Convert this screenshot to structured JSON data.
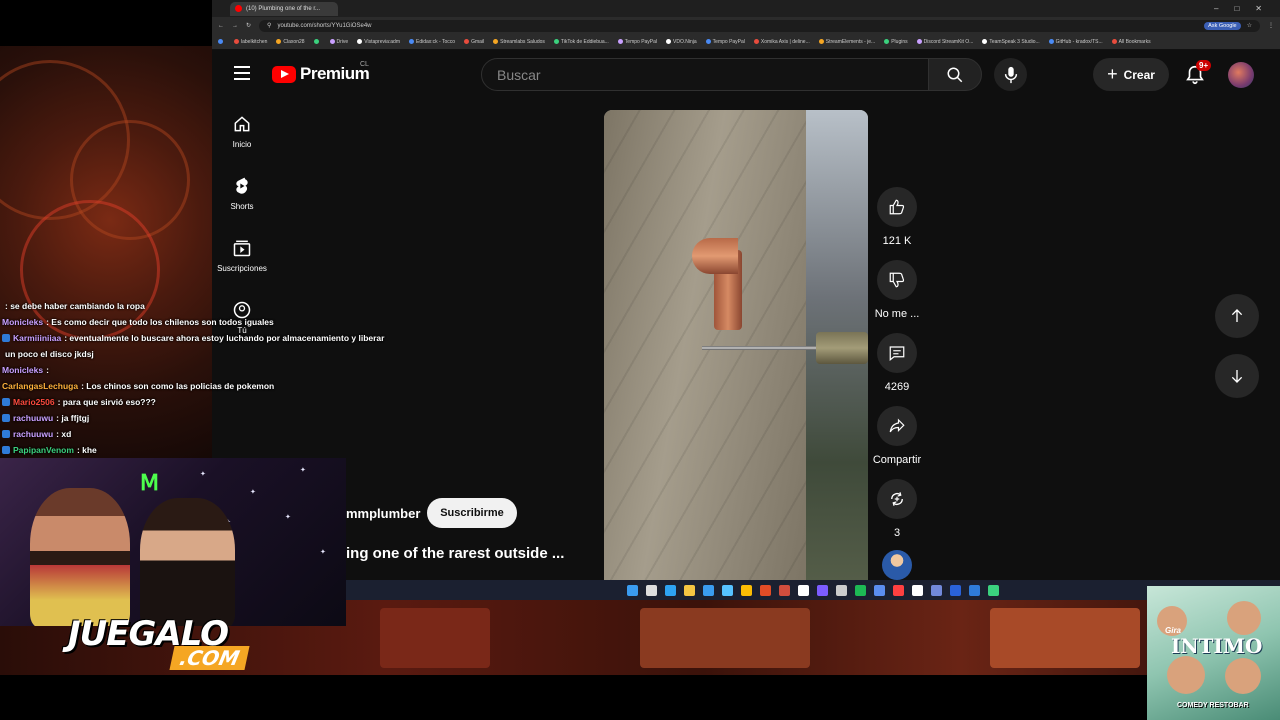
{
  "browser": {
    "tab_title": "(10) Plumbing one of the r...",
    "url": "youtube.com/shorts/YYu1GiOSe4w",
    "ask_google": "Ask Google",
    "bookmarks": [
      "",
      "labelkitchen",
      "Claxon28",
      "",
      "Drive",
      "Vistaprevia:adm",
      "Edidax:ck - Tocco",
      "Gmail",
      "Streamlabs Saludos",
      "TikTok de Eddiebua...",
      "Tempo PayPal",
      "VDO.Ninja",
      "Tempo PayPal",
      "Xomika Axis | deline...",
      "StreamElements - je...",
      "Plugins",
      "Discord StreamKit O...",
      "TeamSpeak 3 Studio...",
      "GitHub - kradox/TS...",
      "All Bookmarks"
    ]
  },
  "youtube": {
    "logo_text": "Premium",
    "country": "CL",
    "search_placeholder": "Buscar",
    "create_label": "Crear",
    "notifications_badge": "9+",
    "nav": [
      {
        "label": "Inicio"
      },
      {
        "label": "Shorts"
      },
      {
        "label": "Suscripciones"
      },
      {
        "label": "Tú"
      }
    ],
    "short": {
      "channel": "mmplumber",
      "subscribe_label": "Suscribirme",
      "title": "ing one of the rarest outside ..."
    },
    "actions": {
      "likes": "121 K",
      "dislike_label": "No me ...",
      "comments": "4269",
      "share_label": "Compartir",
      "remix_count": "3"
    }
  },
  "chat": [
    {
      "user": "",
      "text": ": se debe haber cambiando la ropa",
      "color": "#b06bd8"
    },
    {
      "user": "Monicleks",
      "text": ": Es como decir que todo los chilenos son todos iguales",
      "color": "#c9a0ff"
    },
    {
      "user": "Karmiiiniiaa",
      "text": ": eventualmente lo buscare ahora estoy luchando por almacenamiento y liberar",
      "color": "#c9a0ff",
      "badge": true
    },
    {
      "user": "",
      "text": "un poco el disco jkdsj",
      "color": "#fff"
    },
    {
      "user": "Monicleks",
      "text": ":",
      "color": "#c9a0ff"
    },
    {
      "user": "CarlangasLechuga",
      "text": ": Los chinos son como las policias de pokemon",
      "color": "#ffb13b"
    },
    {
      "user": "Mario2506",
      "text": ": para que sirvió eso???",
      "color": "#ff4b3e",
      "badge": true
    },
    {
      "user": "rachuuwu",
      "text": ": ja ffjtgj",
      "color": "#c9a0ff",
      "badge": true
    },
    {
      "user": "rachuuwu",
      "text": ": xd",
      "color": "#c9a0ff",
      "badge": true
    },
    {
      "user": "PapipanVenom",
      "text": ": khe",
      "color": "#3bd17e",
      "badge": true
    }
  ],
  "overlay": {
    "logo_main": "JUEGALO",
    "logo_sub": ".COM",
    "ad_line1": "Gira",
    "ad_line2": "INTIMO",
    "ad_line3": "COMEDY RESTOBAR"
  }
}
